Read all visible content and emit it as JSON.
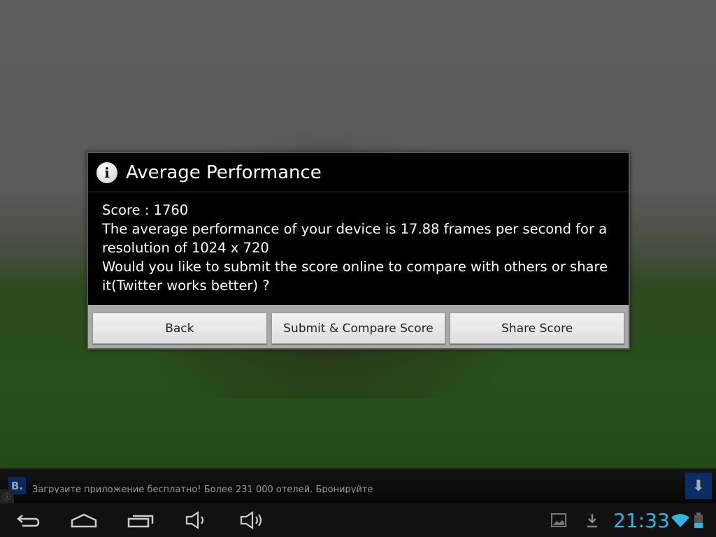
{
  "dialog": {
    "icon": "info-icon",
    "title": "Average Performance",
    "score_line": "Score : 1760",
    "message_line1": "The average performance of your device is 17.88 frames per second for a resolution of  1024 x 720",
    "message_line2": "Would you like to submit the score online to compare with others or share it(Twitter works better) ?",
    "buttons": {
      "back": "Back",
      "submit": "Submit & Compare Score",
      "share": "Share Score"
    }
  },
  "ad": {
    "logo": "B.",
    "text": "Загрузите приложение бесплатно! Более 231 000 отелей. Бронируйте",
    "info_icon": "i",
    "download_icon": "download-icon"
  },
  "status": {
    "time": "21:33",
    "colors": {
      "accent": "#33b5e5"
    }
  }
}
